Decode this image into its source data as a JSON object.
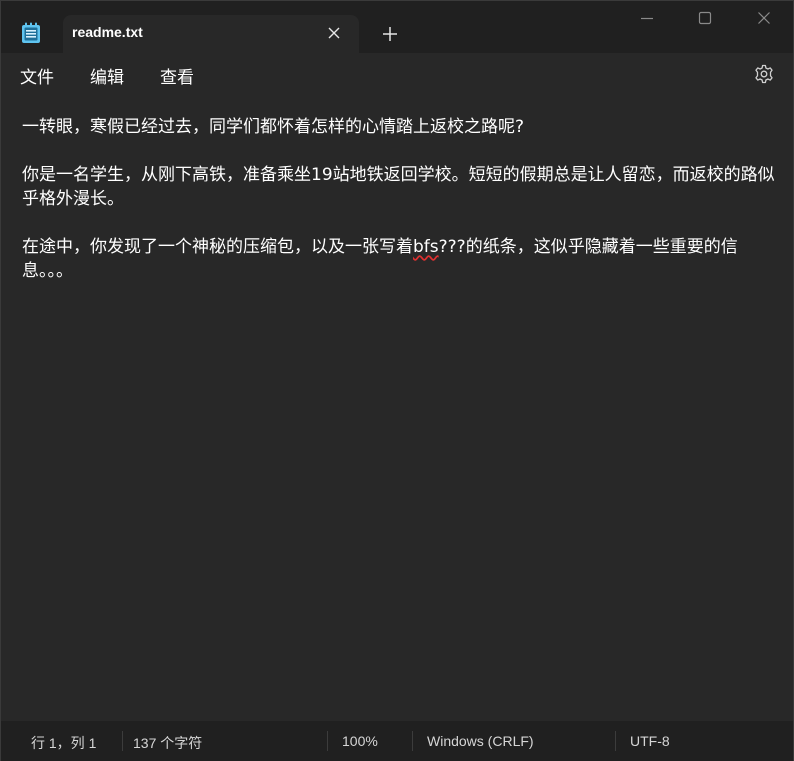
{
  "tab": {
    "title": "readme.txt"
  },
  "menu": {
    "items": [
      "文件",
      "编辑",
      "查看"
    ]
  },
  "editor": {
    "line1": "一转眼，寒假已经过去，同学们都怀着怎样的心情踏上返校之路呢?",
    "line2": "你是一名学生，从刚下高铁，准备乘坐19站地铁返回学校。短短的假期总是让人留恋，而返校的路似乎格外漫长。",
    "line3_before": "在途中，你发现了一个神秘的压缩包，以及一张写着",
    "line3_marked": "bfs",
    "line3_after": "???的纸条，这似乎隐藏着一些重要的信息。。。"
  },
  "status": {
    "position": "行 1，列 1",
    "chars": "137 个字符",
    "zoom": "100%",
    "line_ending": "Windows (CRLF)",
    "encoding": "UTF-8"
  },
  "icons": {
    "app": "notepad-icon",
    "close_tab": "close-icon",
    "new_tab": "plus-icon",
    "minimize": "minimize-icon",
    "maximize": "maximize-icon",
    "close_window": "close-window-icon",
    "settings": "gear-icon"
  },
  "colors": {
    "background": "#282828",
    "titlebar": "#202020",
    "text": "#ffffff",
    "spellcheck": "#e03030",
    "icon_accent": "#4fc3f7"
  }
}
